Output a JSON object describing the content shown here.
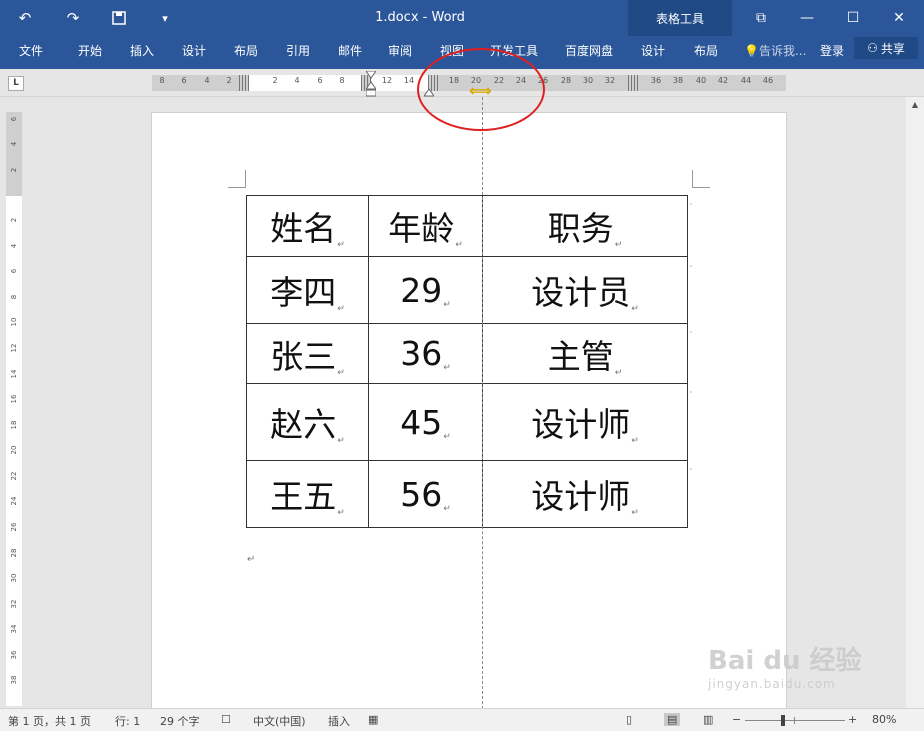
{
  "window": {
    "title": "1.docx - Word"
  },
  "context_tab_group": "表格工具",
  "ribbon_tabs": [
    "文件",
    "开始",
    "插入",
    "设计",
    "布局",
    "引用",
    "邮件",
    "审阅",
    "视图",
    "开发工具",
    "百度网盘",
    "设计",
    "布局"
  ],
  "tell_me": "告诉我...",
  "login": "登录",
  "share": "共享",
  "ruler_labels": [
    "8",
    "6",
    "4",
    "2",
    "2",
    "4",
    "6",
    "8",
    "12",
    "14",
    "18",
    "20",
    "22",
    "24",
    "26",
    "28",
    "30",
    "32",
    "36",
    "38",
    "40",
    "42",
    "44",
    "46"
  ],
  "vruler_labels": [
    "6",
    "4",
    "2",
    "2",
    "4",
    "6",
    "8",
    "10",
    "12",
    "14",
    "16",
    "18",
    "20",
    "22",
    "24",
    "26",
    "28",
    "30",
    "32",
    "34",
    "36",
    "38"
  ],
  "table": {
    "headers": [
      "姓名",
      "年龄",
      "职务"
    ],
    "rows": [
      [
        "李四",
        "29",
        "设计员"
      ],
      [
        "张三",
        "36",
        "主管"
      ],
      [
        "赵六",
        "45",
        "设计师"
      ],
      [
        "王五",
        "56",
        "设计师"
      ]
    ]
  },
  "paragraph_mark": "↵",
  "status": {
    "page": "第 1 页，共 1 页",
    "line": "行: 1",
    "words": "29 个字",
    "language": "中文(中国)",
    "insert_mode": "插入",
    "zoom": "80%"
  },
  "watermark": {
    "main": "Bai du 经验",
    "sub": "jingyan.baidu.com"
  }
}
